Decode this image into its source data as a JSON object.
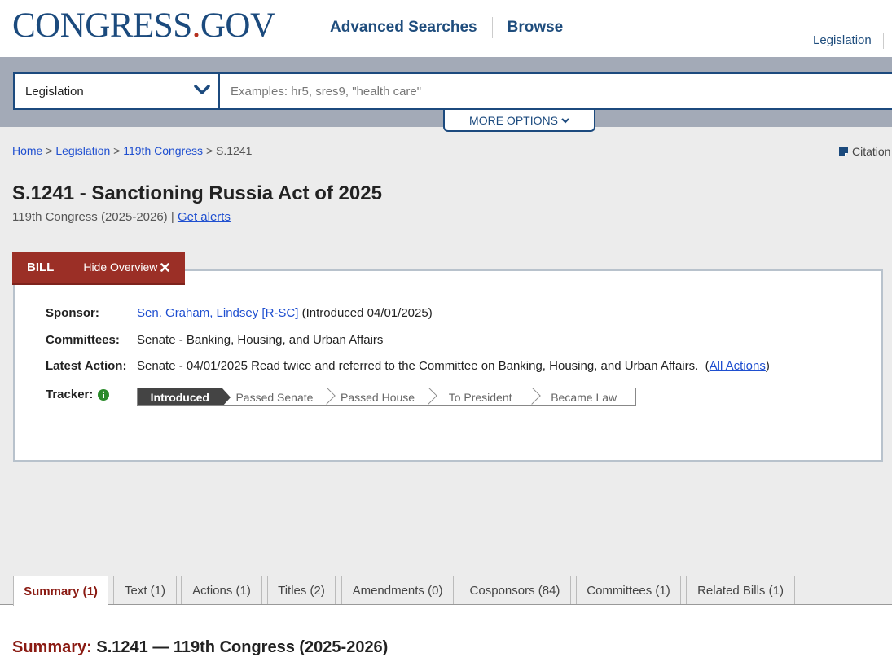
{
  "header": {
    "logo_main": "CONGRESS",
    "logo_dot": ".",
    "logo_tld": "GOV",
    "nav": [
      "Advanced Searches",
      "Browse"
    ],
    "right_link": "Legislation"
  },
  "search": {
    "collection": "Legislation",
    "placeholder": "Examples: hr5, sres9, \"health care\"",
    "more_options": "MORE OPTIONS"
  },
  "breadcrumb": {
    "items": [
      "Home",
      "Legislation",
      "119th Congress"
    ],
    "sep": ">",
    "current": "S.1241"
  },
  "citation": "Citation",
  "bill": {
    "title": "S.1241 - Sanctioning Russia Act of 2025",
    "congress": "119th Congress (2025-2026)",
    "pipe": "|",
    "get_alerts": "Get alerts"
  },
  "overview": {
    "tab_label": "BILL",
    "hide_label": "Hide Overview",
    "sponsor_label": "Sponsor:",
    "sponsor_name": "Sen. Graham, Lindsey [R-SC]",
    "sponsor_intro": "(Introduced 04/01/2025)",
    "committees_label": "Committees:",
    "committees_value": "Senate - Banking, Housing, and Urban Affairs",
    "latest_label": "Latest Action:",
    "latest_value": "Senate - 04/01/2025 Read twice and referred to the Committee on Banking, Housing, and Urban Affairs.",
    "all_actions_open": "(",
    "all_actions": "All Actions",
    "all_actions_close": ")",
    "tracker_label": "Tracker:",
    "tracker_steps": [
      "Introduced",
      "Passed Senate",
      "Passed House",
      "To President",
      "Became Law"
    ]
  },
  "tabs": [
    "Summary (1)",
    "Text (1)",
    "Actions (1)",
    "Titles (2)",
    "Amendments (0)",
    "Cosponsors (84)",
    "Committees (1)",
    "Related Bills (1)"
  ],
  "summary": {
    "label": "Summary:",
    "value": "S.1241 — 119th Congress (2025-2026)"
  },
  "colors": {
    "brand_navy": "#1b4a7d",
    "accent_red": "#9b2f26",
    "link_blue": "#1f4fd0",
    "search_band": "#a3aab7"
  }
}
